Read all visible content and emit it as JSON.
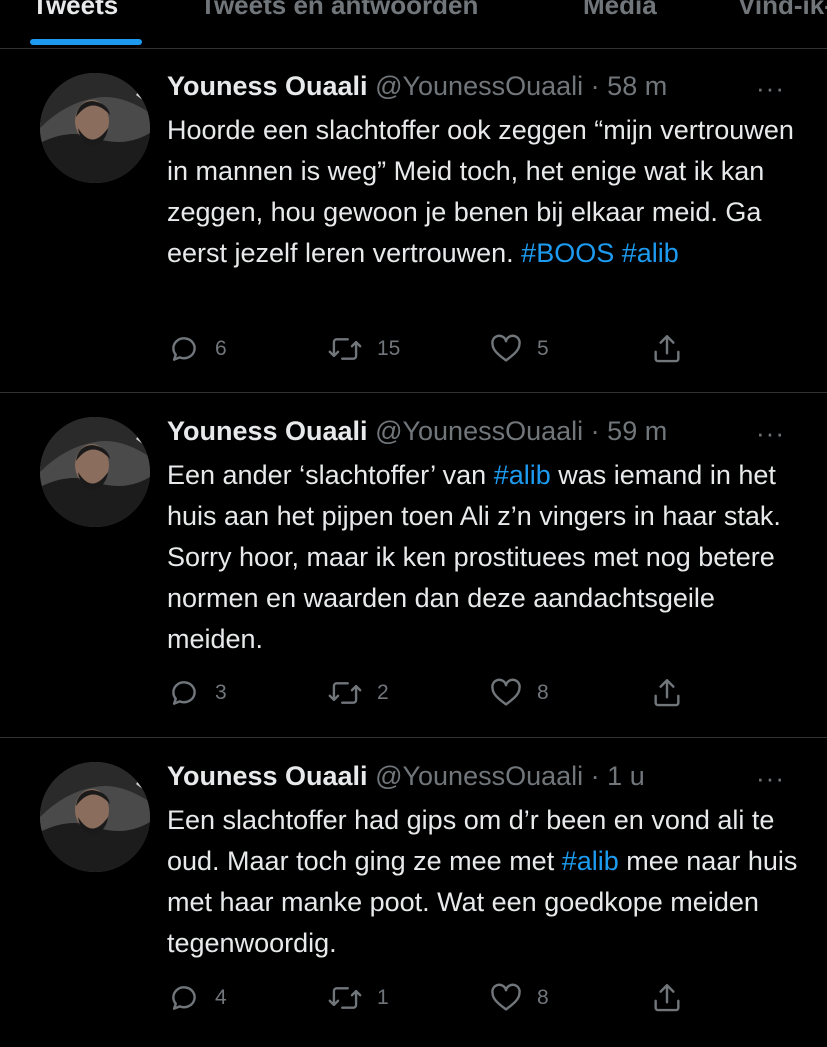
{
  "tabs": [
    "Tweets",
    "Tweets en antwoorden",
    "Media",
    "Vind-ik-leuks"
  ],
  "tweets": [
    {
      "name": "Youness Ouaali",
      "handle": "@YounessOuaali",
      "sep": "·",
      "time": "58 m",
      "more": "···",
      "text": [
        {
          "t": "Hoorde een slachtoffer ook zeggen “mijn vertrouwen in mannen is weg” Meid toch, het enige wat ik kan zeggen, hou gewoon je benen bij elkaar meid. Ga eerst jezelf leren vertrouwen. "
        },
        {
          "t": "#BOOS",
          "tag": true
        },
        {
          "t": " "
        },
        {
          "t": "#alib",
          "tag": true
        }
      ],
      "replies": "6",
      "retweets": "15",
      "likes": "5"
    },
    {
      "name": "Youness Ouaali",
      "handle": "@YounessOuaali",
      "sep": "·",
      "time": "59 m",
      "more": "···",
      "text": [
        {
          "t": "Een ander ‘slachtoffer’ van "
        },
        {
          "t": "#alib",
          "tag": true
        },
        {
          "t": " was iemand in het huis aan het pijpen toen Ali z’n vingers in haar stak. Sorry hoor, maar ik ken prostituees met nog betere normen en waarden dan deze aandachtsgeile meiden."
        }
      ],
      "replies": "3",
      "retweets": "2",
      "likes": "8"
    },
    {
      "name": "Youness Ouaali",
      "handle": "@YounessOuaali",
      "sep": "·",
      "time": "1 u",
      "more": "···",
      "text": [
        {
          "t": "Een slachtoffer had gips om d’r been en vond ali te oud. Maar toch ging ze mee met "
        },
        {
          "t": "#alib",
          "tag": true
        },
        {
          "t": " mee naar huis met haar manke poot. Wat een goedkope meiden tegenwoordig."
        }
      ],
      "replies": "4",
      "retweets": "1",
      "likes": "8"
    }
  ],
  "colors": {
    "background": "#000000",
    "text": "#e7e9ea",
    "secondary": "#71767b",
    "accent": "#1d9bf0",
    "divider": "#2f3336"
  },
  "icons": {
    "reply": "reply-icon",
    "retweet": "retweet-icon",
    "like": "like-icon",
    "share": "share-icon",
    "more": "more-icon"
  }
}
